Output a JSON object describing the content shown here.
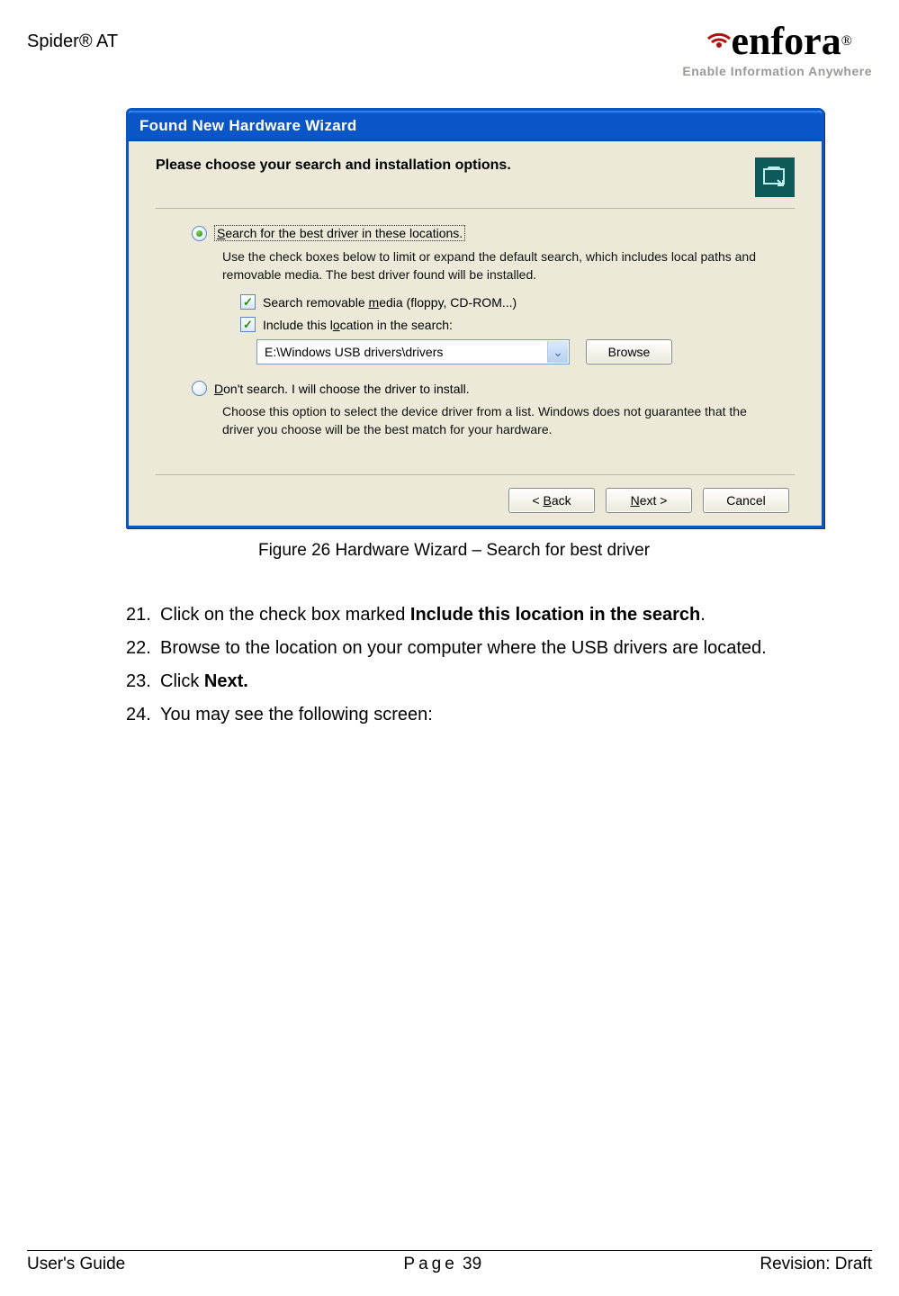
{
  "header": {
    "product": "Spider® AT",
    "logo_text": "enfora",
    "logo_reg": "®",
    "logo_tagline": "Enable Information Anywhere"
  },
  "dialog": {
    "title": "Found New Hardware Wizard",
    "heading": "Please choose your search and installation options.",
    "option1": {
      "label_pre": "S",
      "label_rest": "earch for the best driver in these locations.",
      "description": "Use the check boxes below to limit or expand the default search, which includes local paths and removable media. The best driver found will be installed.",
      "check1_pre": "Search removable ",
      "check1_u": "m",
      "check1_rest": "edia (floppy, CD-ROM...)",
      "check2_pre": "Include this l",
      "check2_u": "o",
      "check2_rest": "cation in the search:",
      "path_value": "E:\\Windows USB drivers\\drivers",
      "browse_label": "Browse"
    },
    "option2": {
      "label_u": "D",
      "label_rest": "on't search. I will choose the driver to install.",
      "description": "Choose this option to select the device driver from a list.  Windows does not guarantee that the driver you choose will be the best match for your hardware."
    },
    "buttons": {
      "back": "< Back",
      "next": "Next >",
      "cancel": "Cancel"
    }
  },
  "caption": "Figure 26 Hardware Wizard – Search for best driver",
  "steps": {
    "s21_num": "21.",
    "s21_a": "Click on the check box marked ",
    "s21_b": "Include this location in the search",
    "s21_c": ".",
    "s22_num": "22.",
    "s22": "Browse to the location on your computer where the USB drivers are located.",
    "s23_num": "23.",
    "s23_a": "Click ",
    "s23_b": "Next.",
    "s24_num": "24.",
    "s24": "You may see the following screen:"
  },
  "footer": {
    "left": "User's Guide",
    "center_label": "Page",
    "center_num": " 39",
    "right": "Revision: Draft"
  }
}
